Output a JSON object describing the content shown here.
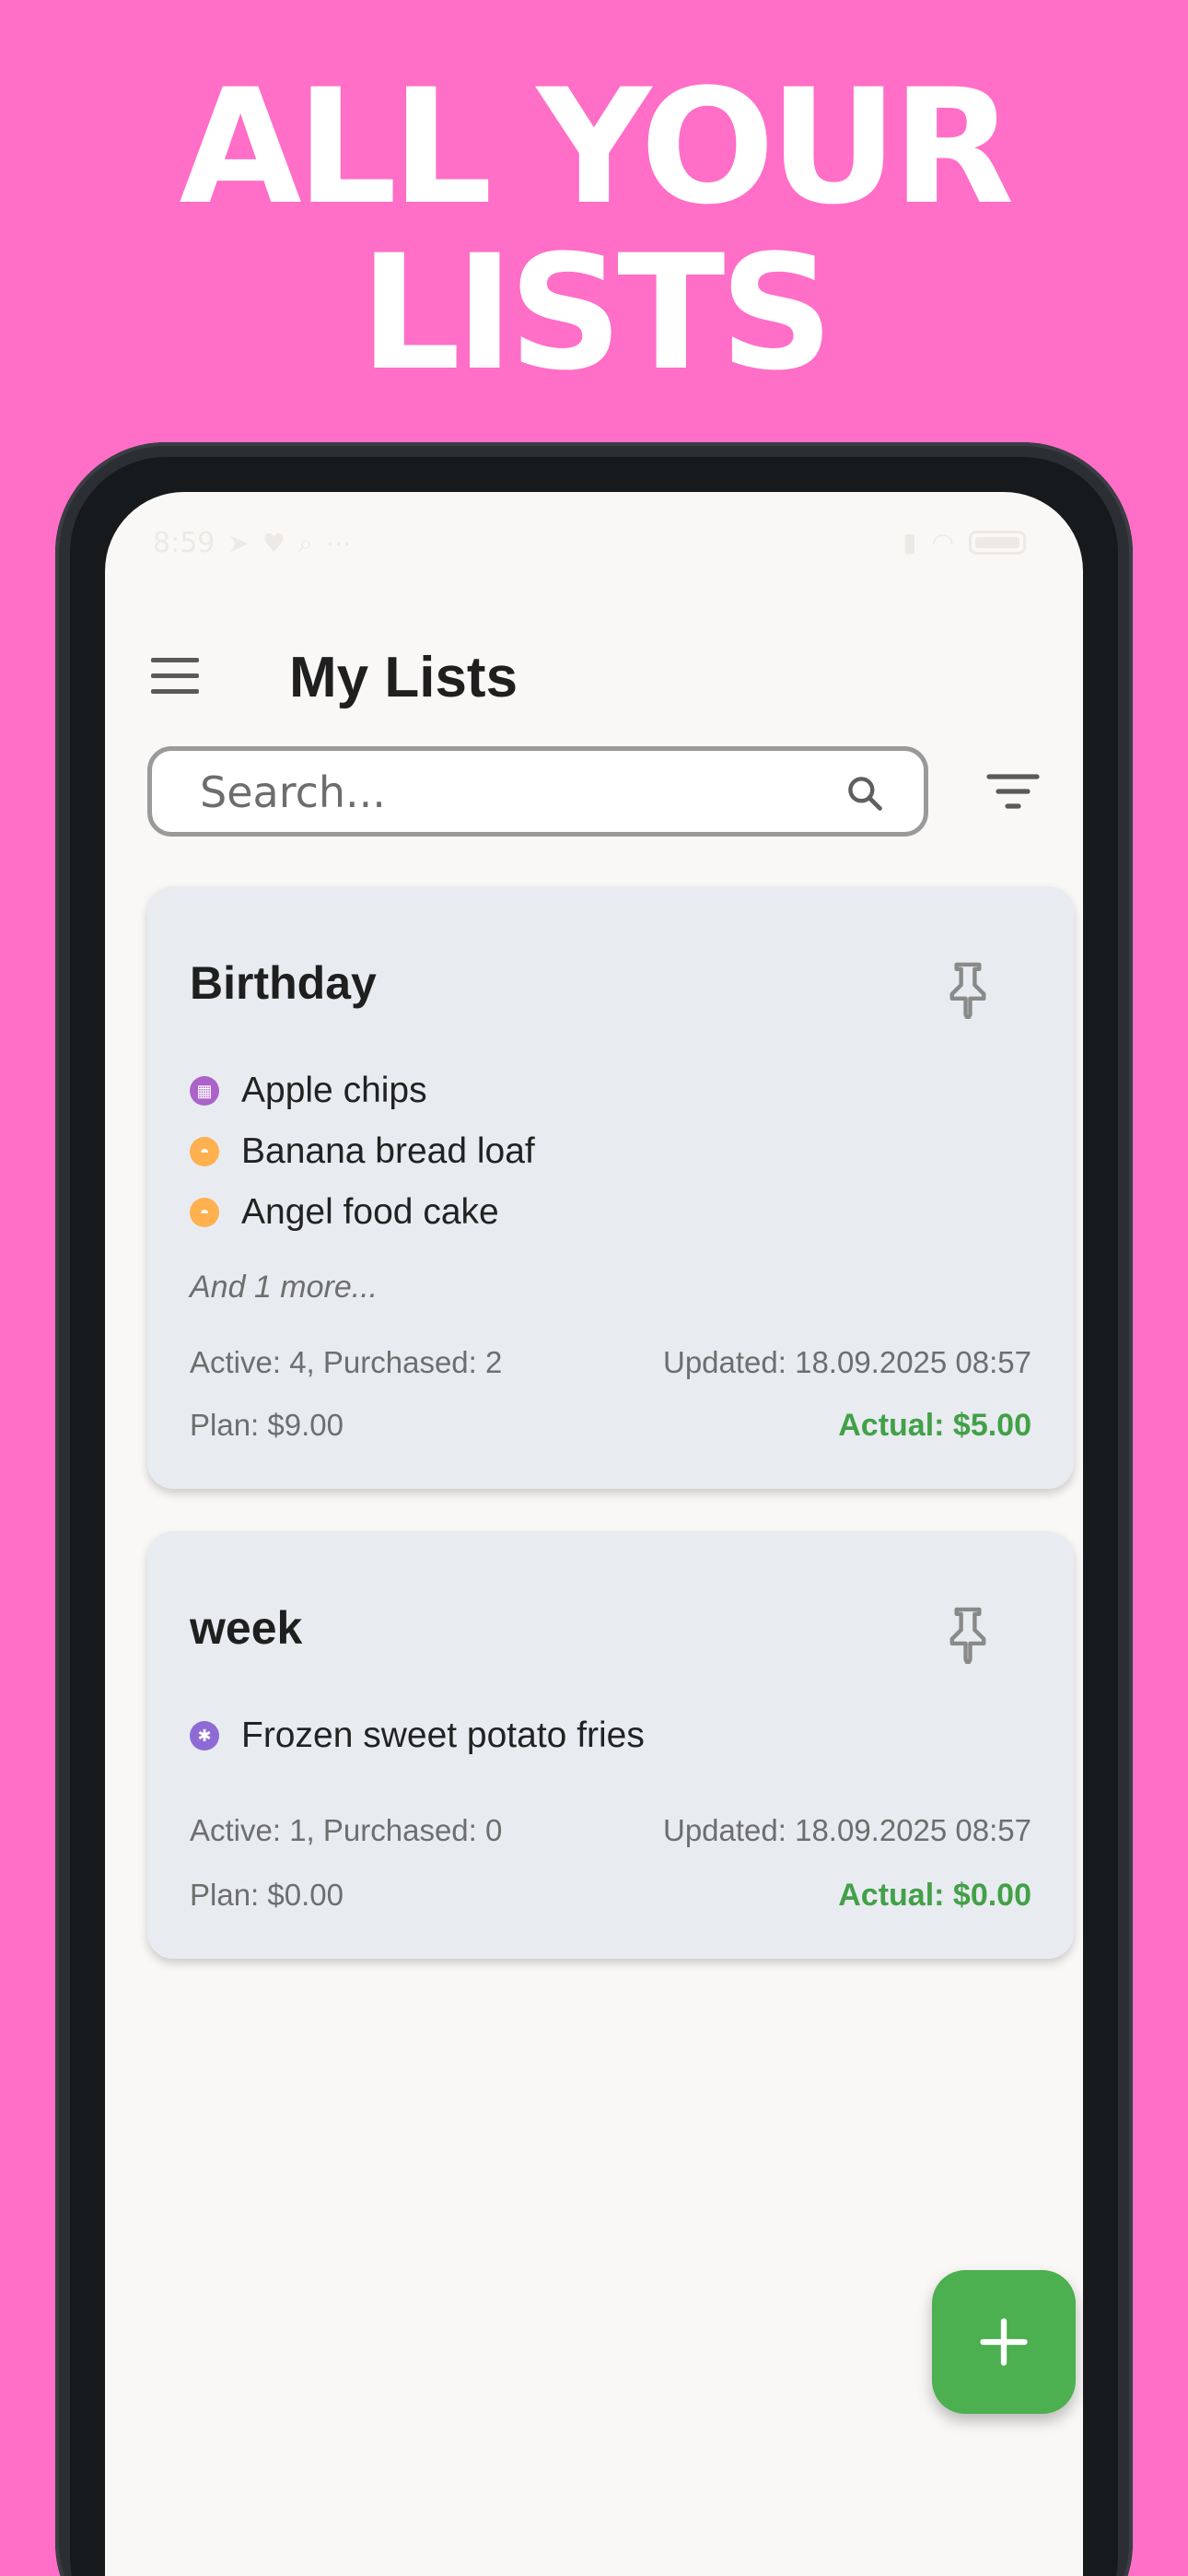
{
  "promo": {
    "headline_line1": "ALL YOUR",
    "headline_line2": "LISTS",
    "background_color": "#FF6EC7"
  },
  "status_bar": {
    "time": "8:59",
    "icons": [
      "telegram-icon",
      "heart-icon",
      "search-icon",
      "more-dots-icon",
      "signal-icon",
      "wifi-icon",
      "battery-icon"
    ]
  },
  "app_bar": {
    "title": "My Lists",
    "menu_icon": "hamburger-menu-icon"
  },
  "search": {
    "placeholder": "Search...",
    "value": "",
    "icon": "search-icon"
  },
  "filter": {
    "icon": "filter-icon"
  },
  "lists": [
    {
      "title": "Birthday",
      "pin_icon": "pin-icon",
      "items": [
        {
          "label": "Apple chips",
          "category_color": "#AB63C9",
          "icon": "snack-icon"
        },
        {
          "label": "Banana bread loaf",
          "category_color": "#FFB04F",
          "icon": "bakery-icon"
        },
        {
          "label": "Angel food cake",
          "category_color": "#FFB04F",
          "icon": "bakery-icon"
        }
      ],
      "more_text": "And 1 more...",
      "counts_text": "Active: 4, Purchased: 2",
      "updated_text": "Updated: 18.09.2025 08:57",
      "plan_text": "Plan: $9.00",
      "actual_text": "Actual: $5.00"
    },
    {
      "title": "week",
      "pin_icon": "pin-icon",
      "items": [
        {
          "label": "Frozen sweet potato fries",
          "category_color": "#8E6BD4",
          "icon": "snowflake-icon"
        }
      ],
      "counts_text": "Active: 1, Purchased: 0",
      "updated_text": "Updated: 18.09.2025 08:57",
      "plan_text": "Plan: $0.00",
      "actual_text": "Actual: $0.00"
    }
  ],
  "fab": {
    "icon": "plus-icon",
    "color": "#4CAF50"
  },
  "colors": {
    "card_background": "#E8ECF1",
    "actual_green": "#43A047"
  }
}
